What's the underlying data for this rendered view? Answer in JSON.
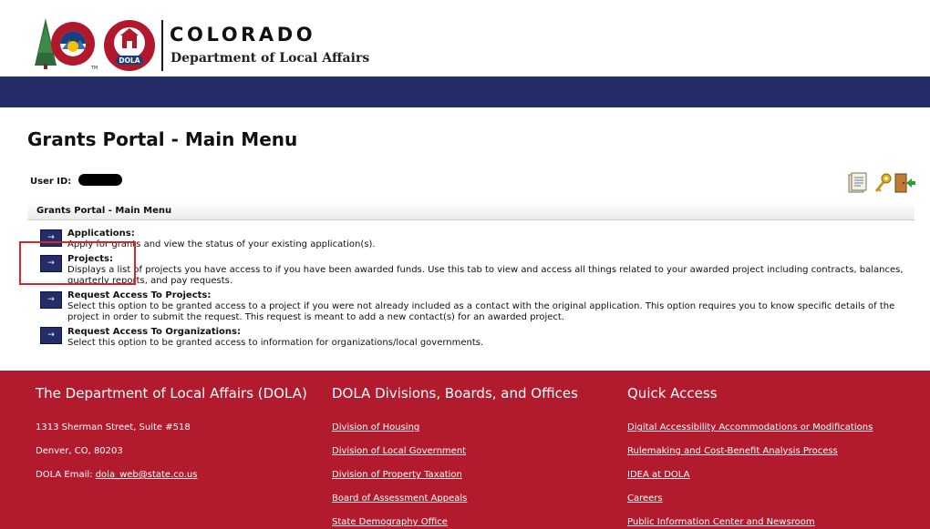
{
  "header": {
    "state_name": "COLORADO",
    "department_name": "Department of Local Affairs",
    "seal_text": "DOLA",
    "logo_mark": "TM"
  },
  "page": {
    "title": "Grants Portal - Main Menu",
    "user_id_label": "User ID:"
  },
  "toolbar": {
    "icons": [
      "report-icon",
      "key-icon",
      "exit-door-icon"
    ]
  },
  "menu": {
    "heading": "Grants Portal - Main Menu",
    "button_glyph": "→",
    "items": [
      {
        "title": "Applications:",
        "description": "Apply for grants and view the status of your existing application(s)."
      },
      {
        "title": "Projects:",
        "description": "Displays a list of projects you have access to if you have been awarded funds. Use this tab to view and access all things related to your awarded project including contracts, balances, quarterly reports, and pay requests."
      },
      {
        "title": "Request Access To Projects:",
        "description": "Select this option to be granted access to a project if you were not already included as a contact with the original application. This option requires you to know specific details of the project in order to submit the request. This request is meant to add a new contact(s) for an awarded project."
      },
      {
        "title": "Request Access To Organizations:",
        "description": "Select this option to be granted access to information for organizations/local governments."
      }
    ]
  },
  "footer": {
    "about": {
      "heading": "The Department of Local Affairs (DOLA)",
      "address": "1313 Sherman Street, Suite #518",
      "city": "Denver, CO, 80203",
      "email_label": "DOLA Email:",
      "email": "dola_web@state.co.us"
    },
    "divisions": {
      "heading": "DOLA Divisions, Boards, and Offices",
      "links": [
        "Division of Housing",
        "Division of Local Government",
        "Division of Property Taxation",
        "Board of Assessment Appeals",
        "State Demography Office"
      ]
    },
    "quick": {
      "heading": "Quick Access",
      "links": [
        "Digital Accessibility Accommodations or Modifications",
        "Rulemaking and Cost-Benefit Analysis Process",
        "IDEA at DOLA",
        "Careers",
        "Public Information Center and Newsroom"
      ]
    }
  },
  "colors": {
    "navy": "#242d68",
    "footer_red": "#b21a2e",
    "highlight": "#d9232d"
  }
}
